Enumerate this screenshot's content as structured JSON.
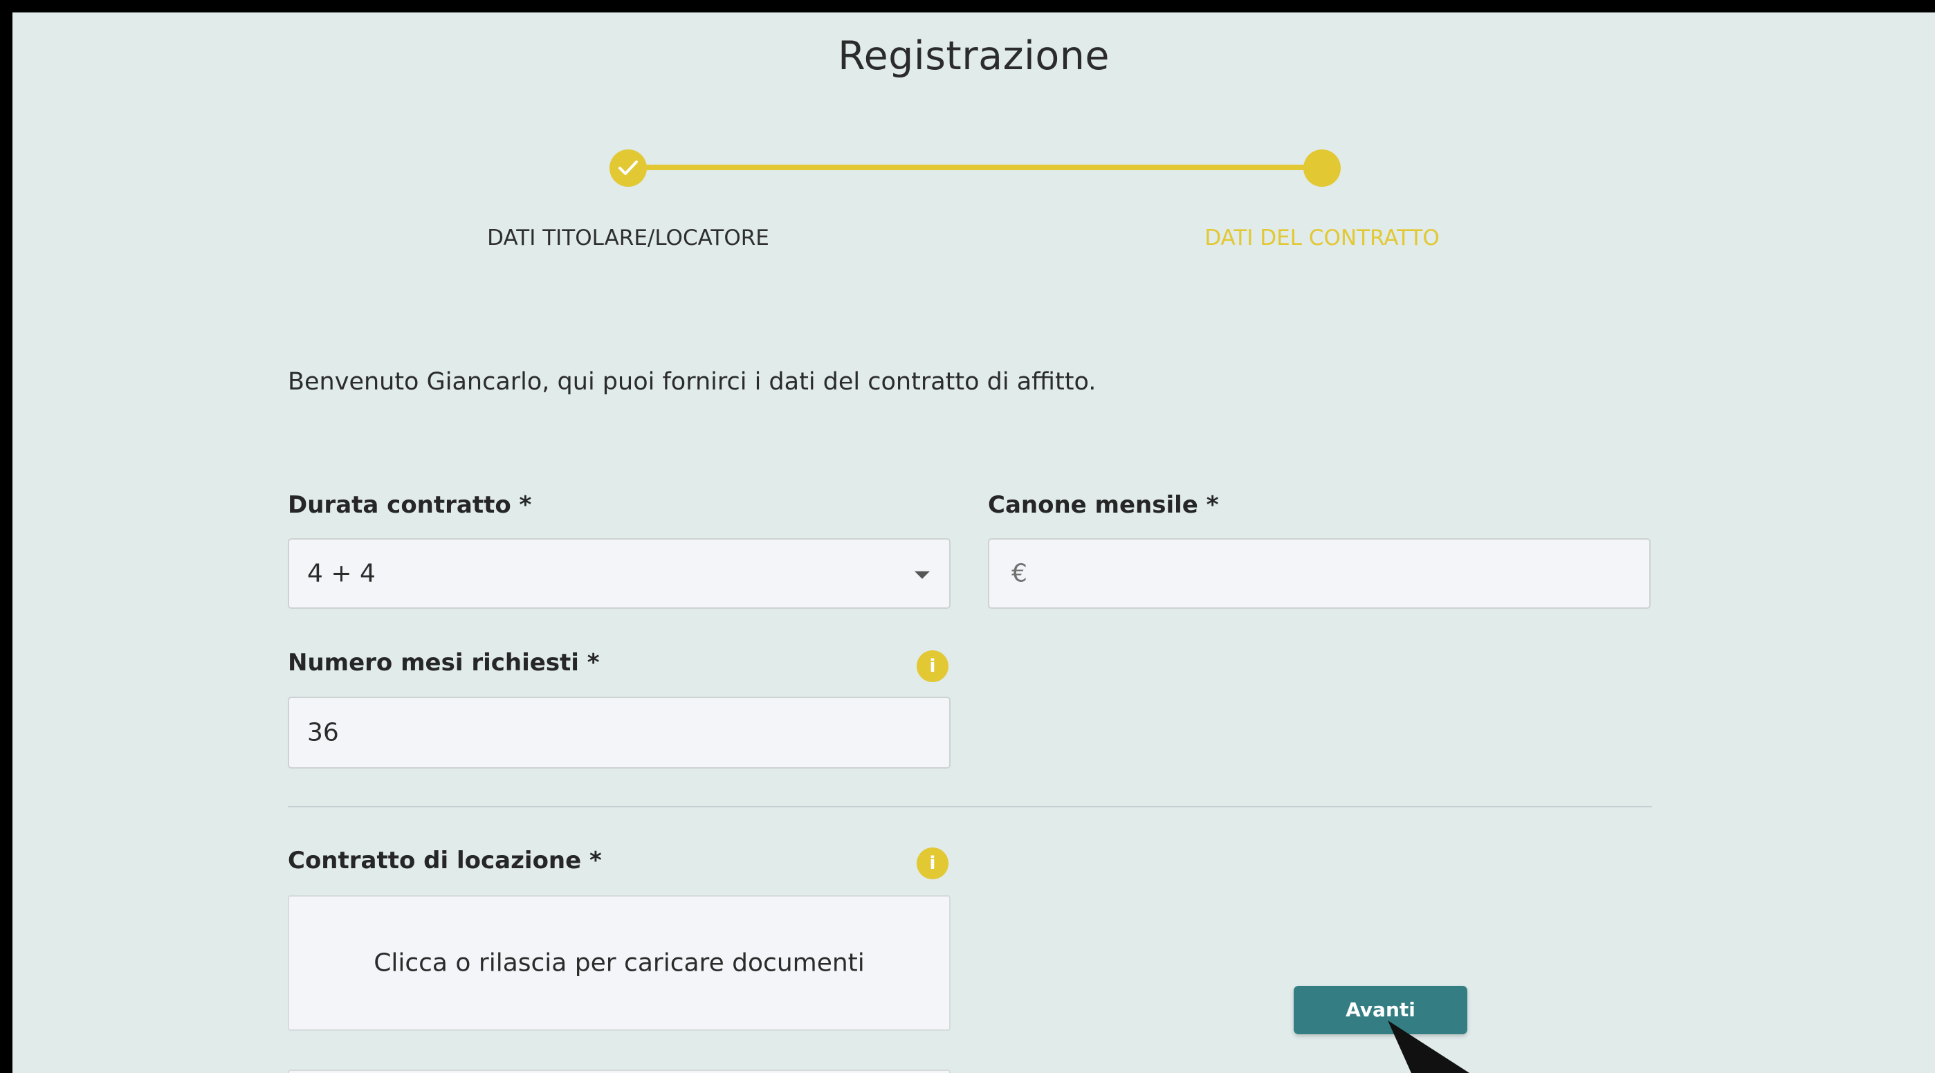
{
  "page": {
    "title": "Registrazione"
  },
  "stepper": {
    "steps": [
      {
        "label": "DATI TITOLARE/LOCATORE",
        "state": "completed"
      },
      {
        "label": "DATI DEL CONTRATTO",
        "state": "active"
      }
    ],
    "check_icon": "check-icon"
  },
  "intro": {
    "text": "Benvenuto Giancarlo, qui puoi fornirci i dati del contratto di affitto."
  },
  "form": {
    "durata": {
      "label": "Durata contratto *",
      "value": "4 + 4",
      "icon": "chevron-down-icon"
    },
    "canone": {
      "label": "Canone mensile *",
      "placeholder": "€",
      "value": ""
    },
    "mesi": {
      "label": "Numero mesi richiesti *",
      "value": "36",
      "info_icon": "i"
    },
    "contratto": {
      "label": "Contratto di locazione *",
      "upload_text": "Clicca o rilascia per caricare documenti",
      "info_icon": "i"
    }
  },
  "actions": {
    "next_label": "Avanti"
  },
  "colors": {
    "background": "#e0ebea",
    "accent_yellow": "#e2c833",
    "primary_teal": "#347e83",
    "frame_border": "#000000"
  }
}
